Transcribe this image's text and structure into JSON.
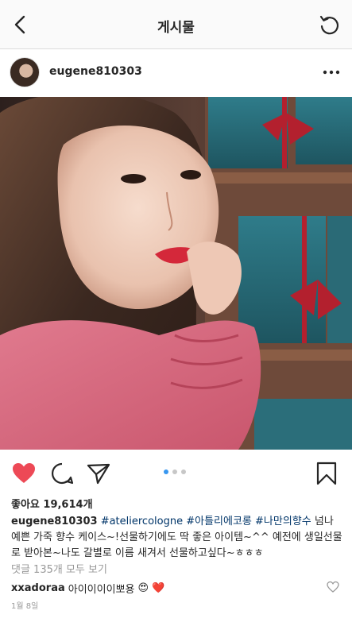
{
  "header": {
    "title": "게시물",
    "back_icon": "chevron-left-icon",
    "refresh_icon": "refresh-icon"
  },
  "post": {
    "username": "eugene810303",
    "more_icon": "more-horizontal-icon",
    "likes": "좋아요 19,614개",
    "caption": {
      "username": "eugene810303",
      "tags": [
        "#ateliercologne",
        "#아틀리에코롱",
        "#나만의향수"
      ],
      "text": "넘나 예쁜 가죽 향수 케이스~!선물하기에도 딱 좋은 아이템~^^ 예전에 생일선물로 받아본~나도 갈별로 이름 새겨서 선물하고싶다~ㅎㅎㅎ"
    },
    "view_all_comments": "댓글 135개 모두 보기",
    "comment": {
      "username": "xxadoraa",
      "text": "아이이이이뽀용",
      "emojis": [
        "😍",
        "❤️"
      ]
    },
    "date": "1월 8일",
    "carousel": {
      "count": 3,
      "active_index": 0
    },
    "colors": {
      "like_red": "#ed4956",
      "carousel_active": "#3897f0",
      "hashtag": "#003569",
      "secondary_text": "#999999"
    }
  }
}
